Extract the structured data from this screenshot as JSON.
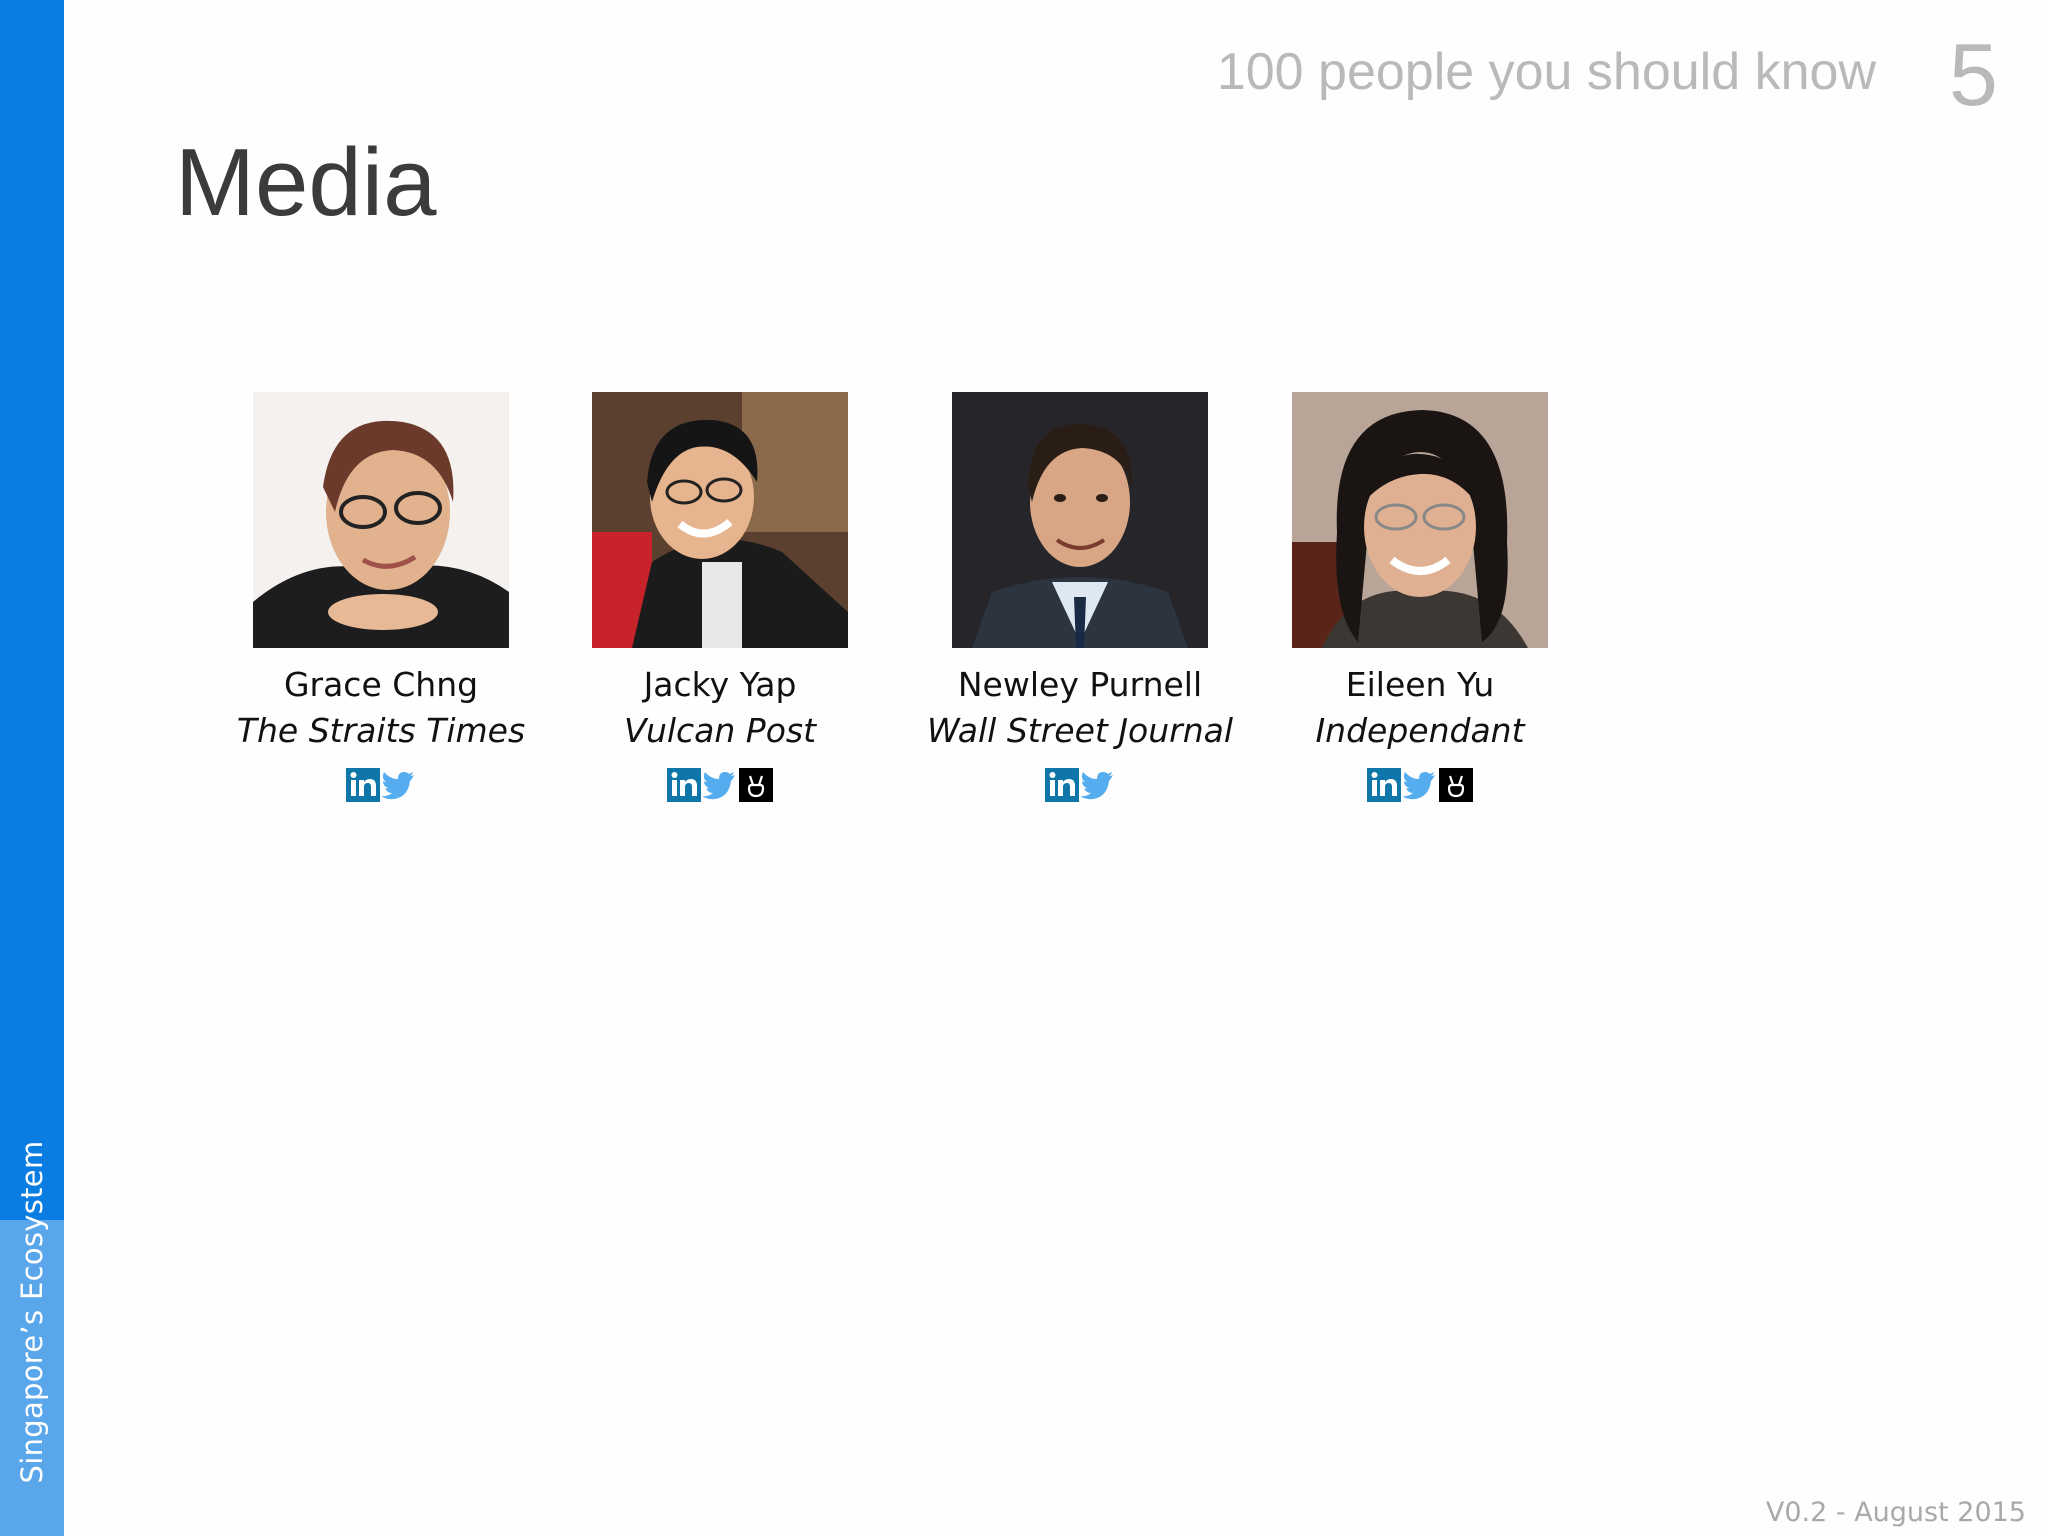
{
  "sidebar": {
    "label": "Singapore’s Ecosystem",
    "color": "#0a7de3"
  },
  "header": {
    "title": "100 people you should know",
    "page_number": "5"
  },
  "page": {
    "heading": "Media"
  },
  "people": [
    {
      "name": "Grace Chng",
      "organization": "The Straits Times",
      "links": [
        "linkedin-icon",
        "twitter-icon"
      ]
    },
    {
      "name": "Jacky Yap",
      "organization": "Vulcan Post",
      "links": [
        "linkedin-icon",
        "twitter-icon",
        "angellist-icon"
      ]
    },
    {
      "name": "Newley Purnell",
      "organization": "Wall Street Journal",
      "links": [
        "linkedin-icon",
        "twitter-icon"
      ]
    },
    {
      "name": "Eileen Yu",
      "organization": "Independant",
      "links": [
        "linkedin-icon",
        "twitter-icon",
        "angellist-icon"
      ]
    }
  ],
  "footer": {
    "version": "V0.2 - August 2015"
  },
  "colors": {
    "linkedin": "#0e76a8",
    "twitter": "#55acee",
    "angellist": "#000000"
  }
}
